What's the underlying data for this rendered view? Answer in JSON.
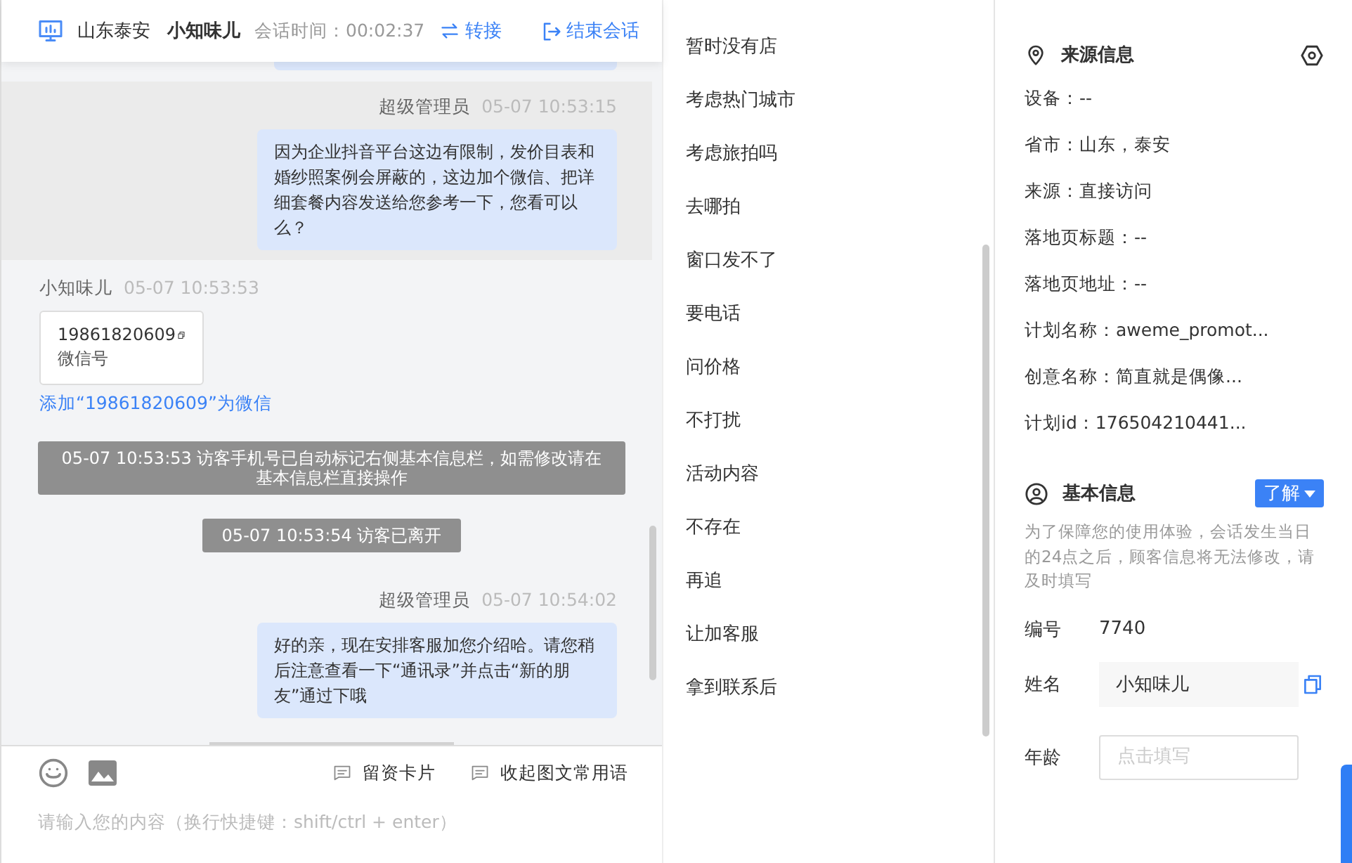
{
  "header": {
    "location": "山东泰安",
    "visitor": "小知味儿",
    "duration": "会话时间：00:02:37",
    "transfer": "转接",
    "end": "结束会话"
  },
  "messages": [
    {
      "kind": "agent",
      "highlighted": true,
      "sender": "超级管理员",
      "time": "05-07 10:53:15",
      "text": "因为企业抖音平台这边有限制，发价目表和婚纱照案例会屏蔽的，这边加个微信、把详细套餐内容发送给您参考一下，您看可以么？"
    },
    {
      "kind": "visitor_card",
      "sender": "小知味儿",
      "time": "05-07 10:53:53",
      "number": "19861820609",
      "label": "微信号",
      "link": "添加“19861820609”为微信"
    },
    {
      "kind": "system",
      "text": "05-07 10:53:53 访客手机号已自动标记右侧基本信息栏，如需修改请在基本信息栏直接操作"
    },
    {
      "kind": "system",
      "text": "05-07 10:53:54 访客已离开"
    },
    {
      "kind": "agent",
      "highlighted": false,
      "sender": "超级管理员",
      "time": "05-07 10:54:02",
      "text": "好的亲，现在安排客服加您介绍哈。请您稍后注意查看一下“通讯录”并点击“新的朋友”通过下哦"
    }
  ],
  "composer": {
    "actions": [
      "留资卡片",
      "收起图文常用语"
    ],
    "placeholder": "请输入您的内容（换行快捷键：shift/ctrl + enter）"
  },
  "phrases": [
    "暂时没有店",
    "考虑热门城市",
    "考虑旅拍吗",
    "去哪拍",
    "窗口发不了",
    "要电话",
    "问价格",
    "不打扰",
    "活动内容",
    "不存在",
    "再追",
    "让加客服",
    "拿到联系后"
  ],
  "source_info": {
    "title": "来源信息",
    "rows": [
      "设备：--",
      "省市：山东，泰安",
      "来源：直接访问",
      "落地页标题：--",
      "落地页地址：--",
      "计划名称：aweme_promot...",
      "创意名称：简直就是偶像...",
      "计划id：176504210441..."
    ]
  },
  "basic_info": {
    "title": "基本信息",
    "learn_more": "了解",
    "note": "为了保障您的使用体验，会话发生当日的24点之后，顾客信息将无法修改，请及时填写",
    "fields": [
      {
        "kind": "text",
        "label": "编号",
        "value": "7740"
      },
      {
        "kind": "readonly",
        "label": "姓名",
        "value": "小知味儿"
      },
      {
        "kind": "input",
        "label": "年龄",
        "placeholder": "点击填写"
      }
    ]
  }
}
